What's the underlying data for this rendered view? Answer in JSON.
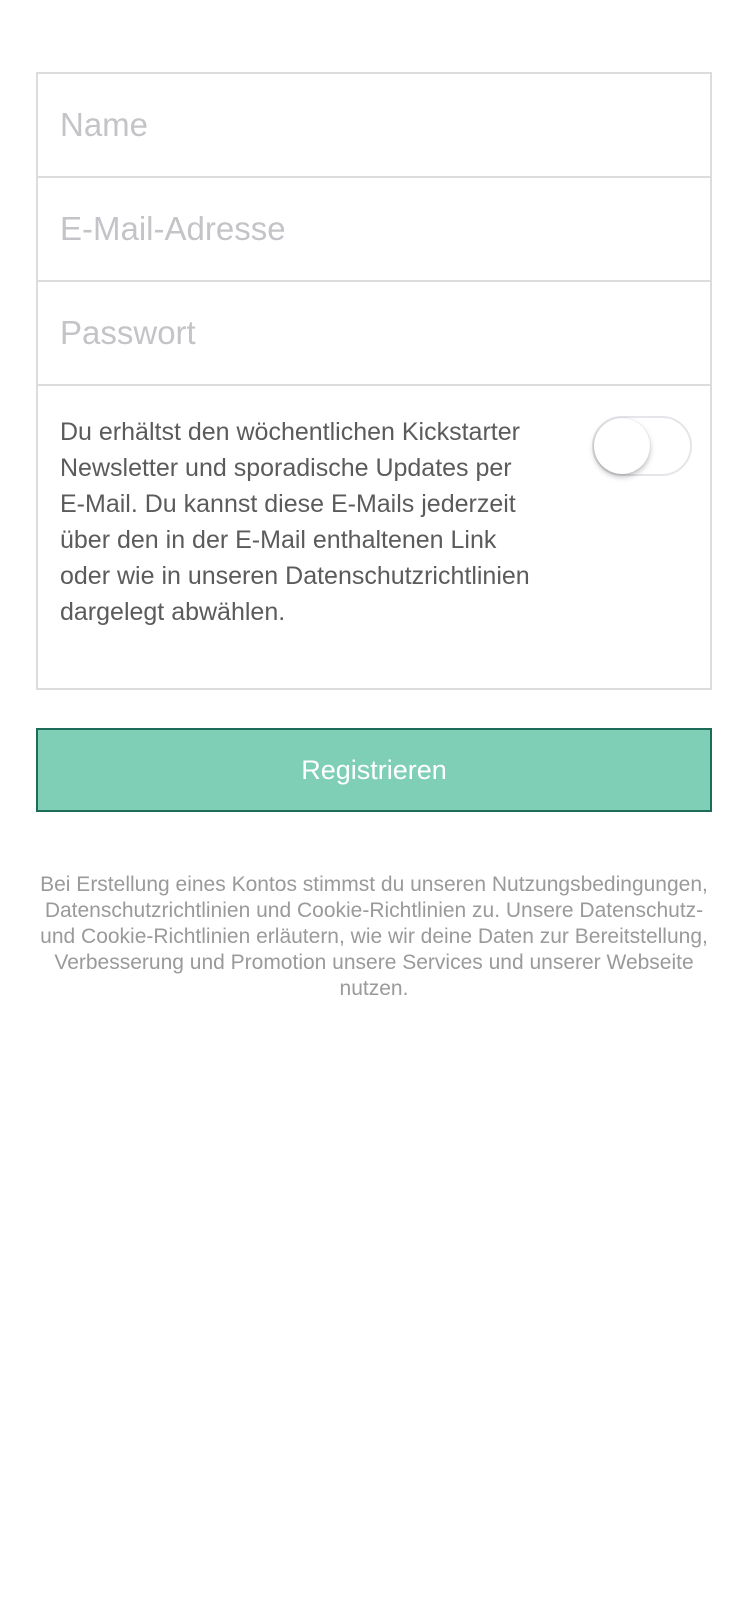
{
  "form": {
    "name_placeholder": "Name",
    "email_placeholder": "E-Mail-Adresse",
    "password_placeholder": "Passwort",
    "name_value": "",
    "email_value": "",
    "password_value": ""
  },
  "newsletter": {
    "text": "Du erhältst den wöchentlichen Kickstarter Newsletter und sporadische Updates per E-Mail. Du kannst diese E-Mails jederzeit über den in der E-Mail enthaltenen Link oder wie in unseren Datenschutzrichtlinien dargelegt abwählen.",
    "toggle_on": false
  },
  "register_button": {
    "label": "Registrieren",
    "color": "#7ecfb5",
    "border_color": "#1f6b5a"
  },
  "terms": {
    "text": "Bei Erstellung eines Kontos stimmst du unseren Nutzungsbedingungen, Datenschutzrichtlinien und Cookie-Richtlinien zu. Unsere Datenschutz- und Cookie-Richtlinien erläutern, wie wir deine Daten zur Bereitstellung, Verbesserung und Promotion unsere Services und unserer Webseite nutzen."
  }
}
